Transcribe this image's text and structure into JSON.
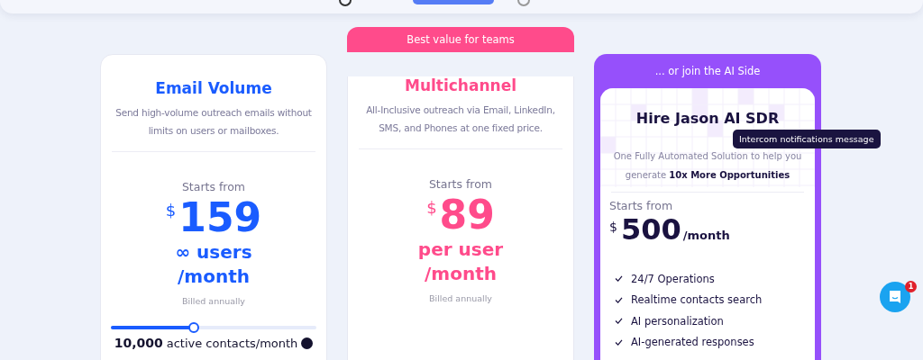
{
  "plans": [
    {
      "kind": "standard",
      "color": "#1a5cff",
      "title": "Email Volume",
      "description": "Send high-volume outreach emails without limits on users or mailboxes.",
      "starts_label": "Starts from",
      "currency": "$",
      "price": "159",
      "unit_lines": [
        "∞ users",
        "/month"
      ],
      "billing": "Billed annually",
      "slider": {
        "level": 0.4
      },
      "contacts": {
        "amount": "10,000",
        "label": "active contacts/month"
      }
    },
    {
      "kind": "standard",
      "color": "#ff4b8b",
      "banner": "Best value for teams",
      "title": "Multichannel",
      "description": "All-Inclusive outreach via Email, LinkedIn, SMS, and Phones at one fixed price.",
      "starts_label": "Starts from",
      "currency": "$",
      "price": "89",
      "unit_lines": [
        "per user",
        "/month"
      ],
      "billing": "Billed annually"
    },
    {
      "kind": "ai",
      "color": "#9650fb",
      "banner": "... or join the AI Side",
      "title": "Hire Jason AI SDR",
      "description": "One Fully Automated Solution to help you generate **10x More Opportunities**",
      "starts_label": "Starts from",
      "currency": "$",
      "price": "500",
      "unit": "/month",
      "features": [
        "24/7 Operations",
        "Realtime contacts search",
        "AI personalization",
        "AI-generated responses"
      ]
    }
  ],
  "tooltip": "Intercom notifications message",
  "chat": {
    "badge": "1"
  }
}
